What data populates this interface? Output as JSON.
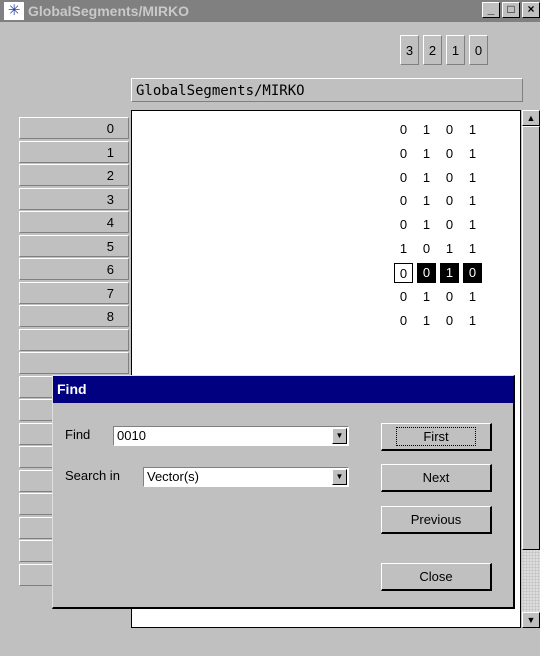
{
  "window": {
    "title": "GlobalSegments/MIRKO",
    "icon": "snowflake-app-icon",
    "controls": [
      "_",
      "□",
      "×"
    ]
  },
  "grid": {
    "bit_headers": [
      "3",
      "2",
      "1",
      "0"
    ],
    "segment_name": "GlobalSegments/MIRKO",
    "rows": [
      {
        "index": "0",
        "bits": [
          "0",
          "1",
          "0",
          "1"
        ]
      },
      {
        "index": "1",
        "bits": [
          "0",
          "1",
          "0",
          "1"
        ]
      },
      {
        "index": "2",
        "bits": [
          "0",
          "1",
          "0",
          "1"
        ]
      },
      {
        "index": "3",
        "bits": [
          "0",
          "1",
          "0",
          "1"
        ]
      },
      {
        "index": "4",
        "bits": [
          "0",
          "1",
          "0",
          "1"
        ]
      },
      {
        "index": "5",
        "bits": [
          "1",
          "0",
          "1",
          "1"
        ]
      },
      {
        "index": "6",
        "bits": [
          "0",
          "0",
          "1",
          "0"
        ],
        "selected": true
      },
      {
        "index": "7",
        "bits": [
          "0",
          "1",
          "0",
          "1"
        ]
      },
      {
        "index": "8",
        "bits": [
          "0",
          "1",
          "0",
          "1"
        ]
      }
    ]
  },
  "find_dialog": {
    "title": "Find",
    "find_label": "Find",
    "find_value": "0010",
    "search_in_label": "Search in",
    "search_in_value": "Vector(s)",
    "buttons": {
      "first": "First",
      "next": "Next",
      "previous": "Previous",
      "close": "Close"
    }
  },
  "colors": {
    "dialog_title_bg": "#000080",
    "inactive_title_bg": "#808080",
    "face": "#c0c0c0"
  }
}
